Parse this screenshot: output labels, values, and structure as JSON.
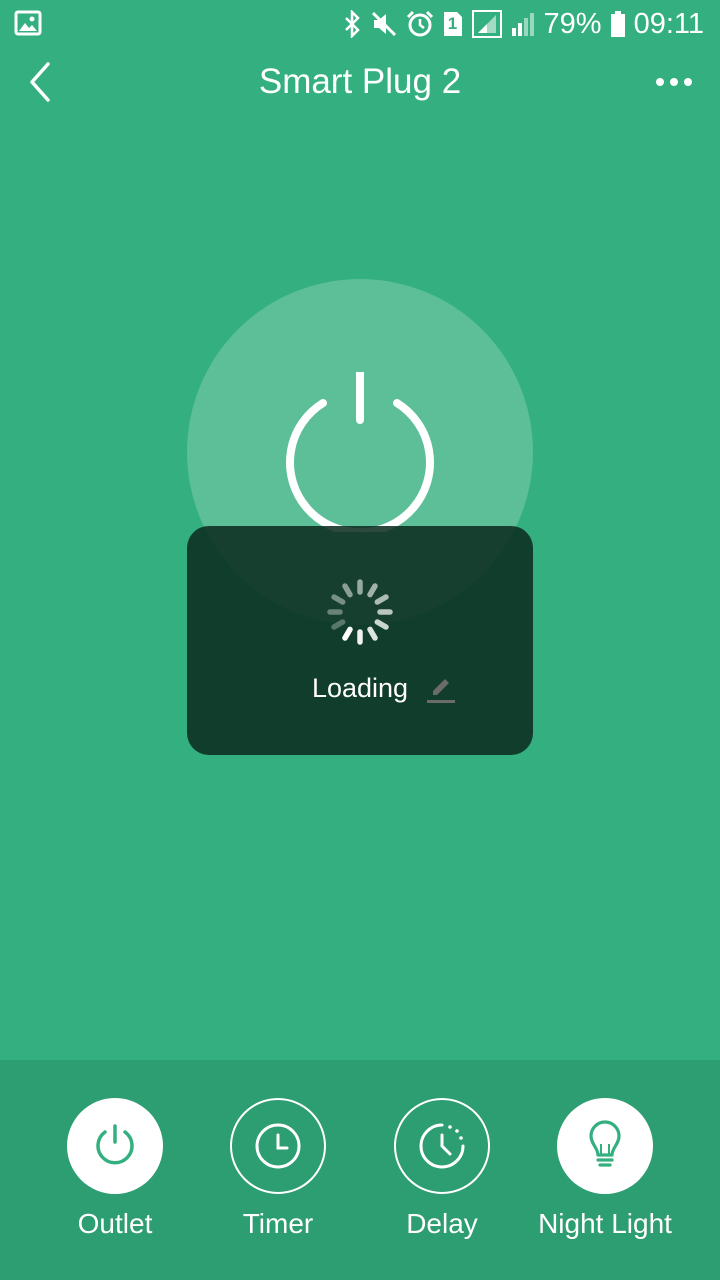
{
  "status_bar": {
    "battery_percent": "79%",
    "time": "09:11",
    "sim_slot": "1",
    "icons": [
      "gallery-icon",
      "bluetooth-icon",
      "mute-icon",
      "alarm-icon",
      "sim-icon",
      "signal-icon",
      "signal-icon",
      "battery-icon"
    ]
  },
  "header": {
    "title": "Smart Plug 2",
    "back_icon": "chevron-left-icon",
    "more_icon": "more-dots-icon"
  },
  "power_button": {
    "icon": "power-icon"
  },
  "loading_dialog": {
    "text": "Loading",
    "spinner_icon": "spinner-icon",
    "edit_icon": "pencil-icon"
  },
  "modes": [
    {
      "label": "Outlet",
      "icon": "power-icon",
      "active": true
    },
    {
      "label": "Timer",
      "icon": "clock-icon",
      "active": false
    },
    {
      "label": "Delay",
      "icon": "delay-clock-icon",
      "active": false
    },
    {
      "label": "Night Light",
      "icon": "bulb-icon",
      "active": true
    }
  ],
  "colors": {
    "background": "#34af7f",
    "bottom_bar": "#2d9d72",
    "accent": "#34af7f",
    "overlay": "#0b2e22"
  }
}
